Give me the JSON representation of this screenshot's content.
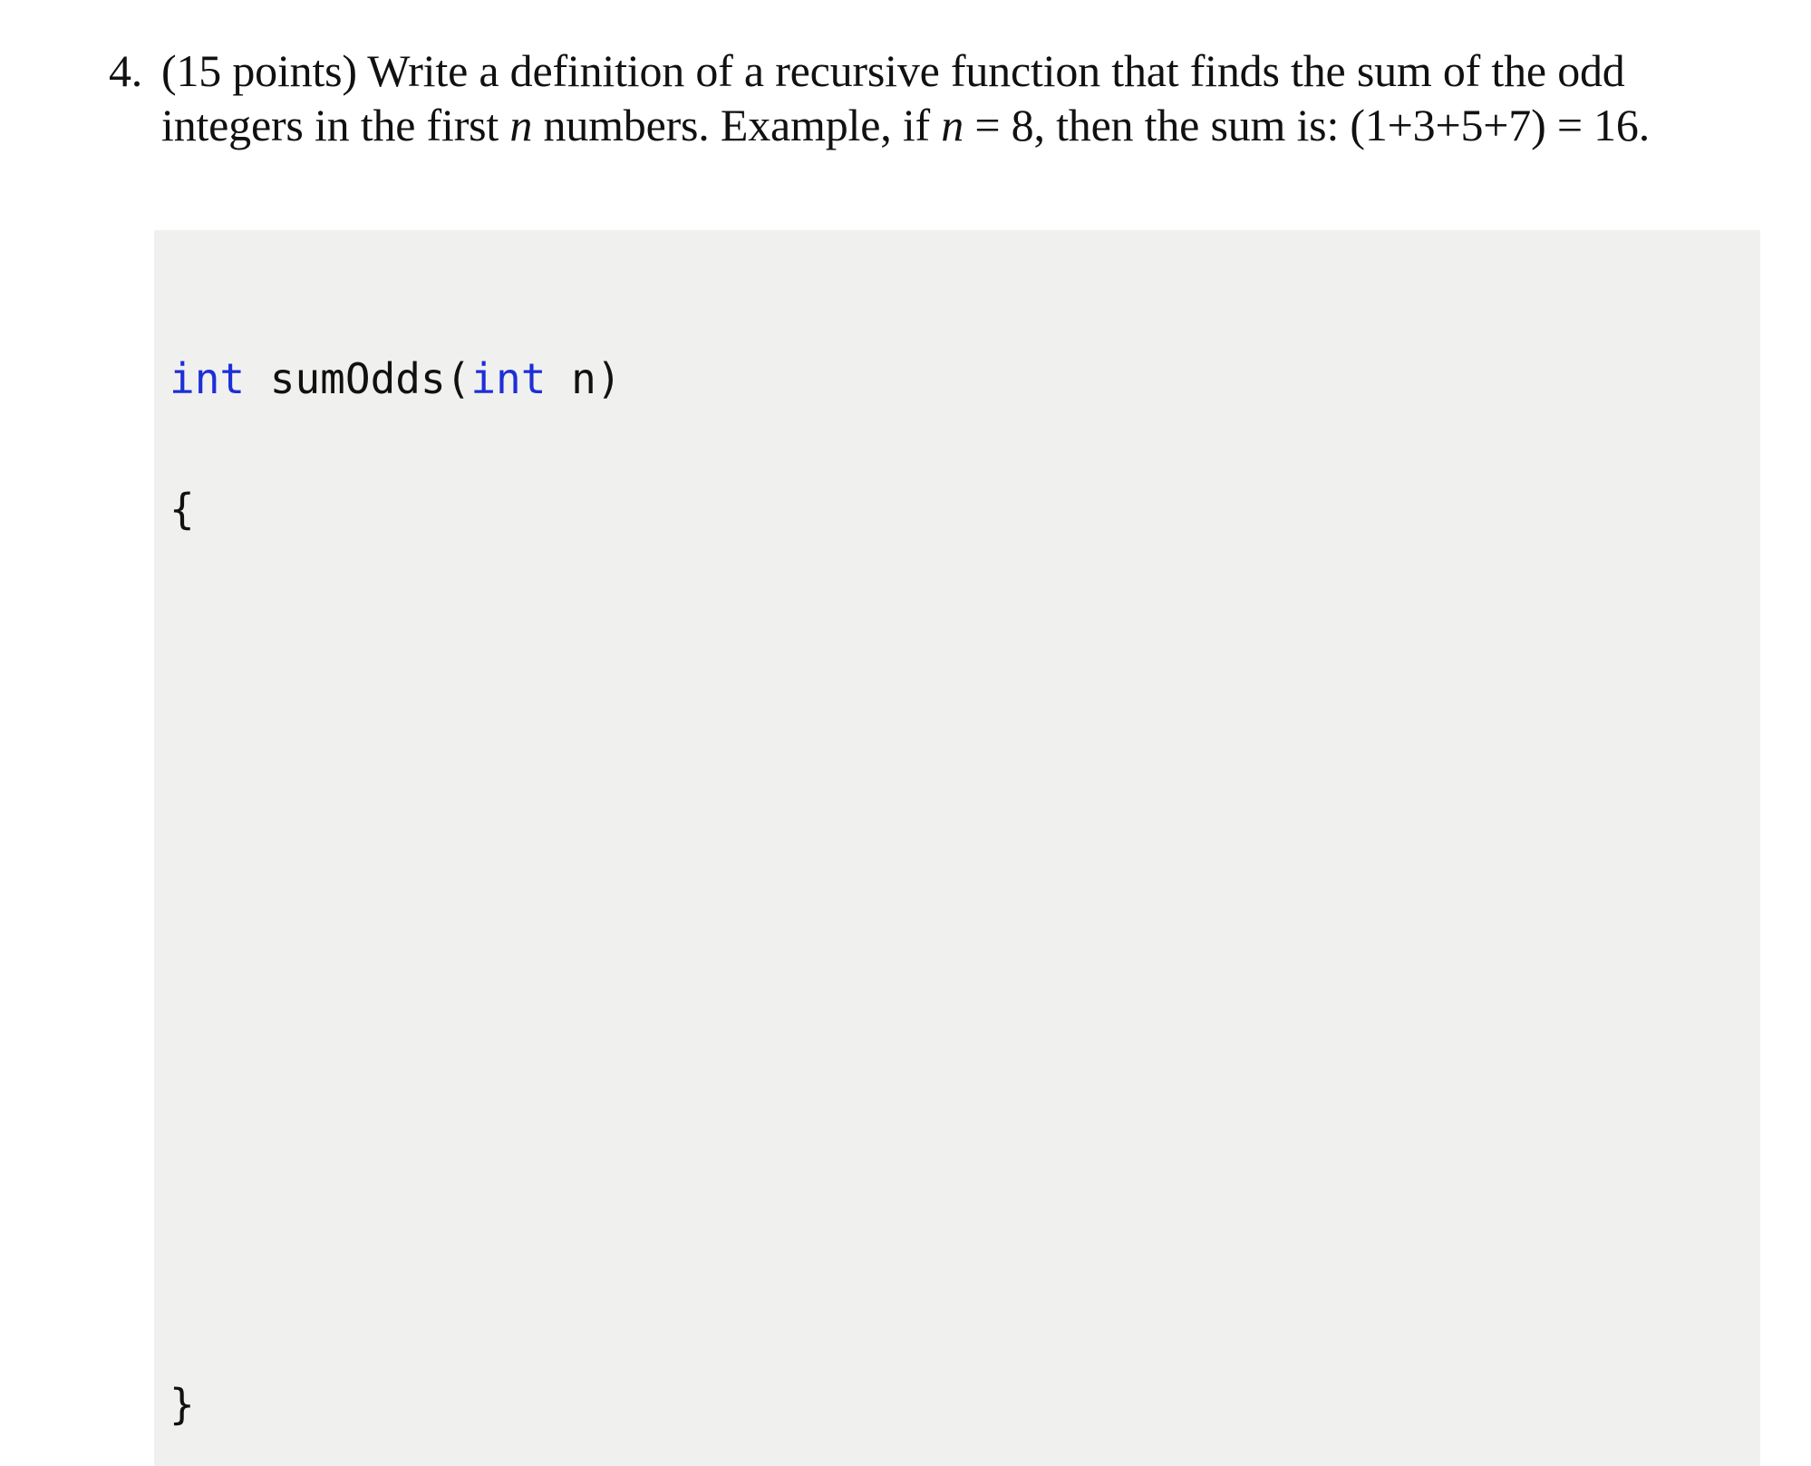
{
  "question": {
    "number": "4.",
    "points": "(15 points)",
    "line1_rest": " Write a definition of a recursive function that finds the sum of the odd",
    "line2_a": "integers in the first ",
    "line2_var": "n",
    "line2_b": " numbers.  Example, if ",
    "line2_var2": "n",
    "line2_c": " = 8, then the sum is:  (1+3+5+7) = 16."
  },
  "answer_box": {
    "background": "#f0f0ef",
    "code": {
      "return_type": "int",
      "function_name": " sumOdds(",
      "param_type": "int",
      "param_rest": " n)",
      "open_brace": "{",
      "close_brace": "}"
    },
    "keyword_color": "#1d2fd6",
    "answer_area": ""
  }
}
